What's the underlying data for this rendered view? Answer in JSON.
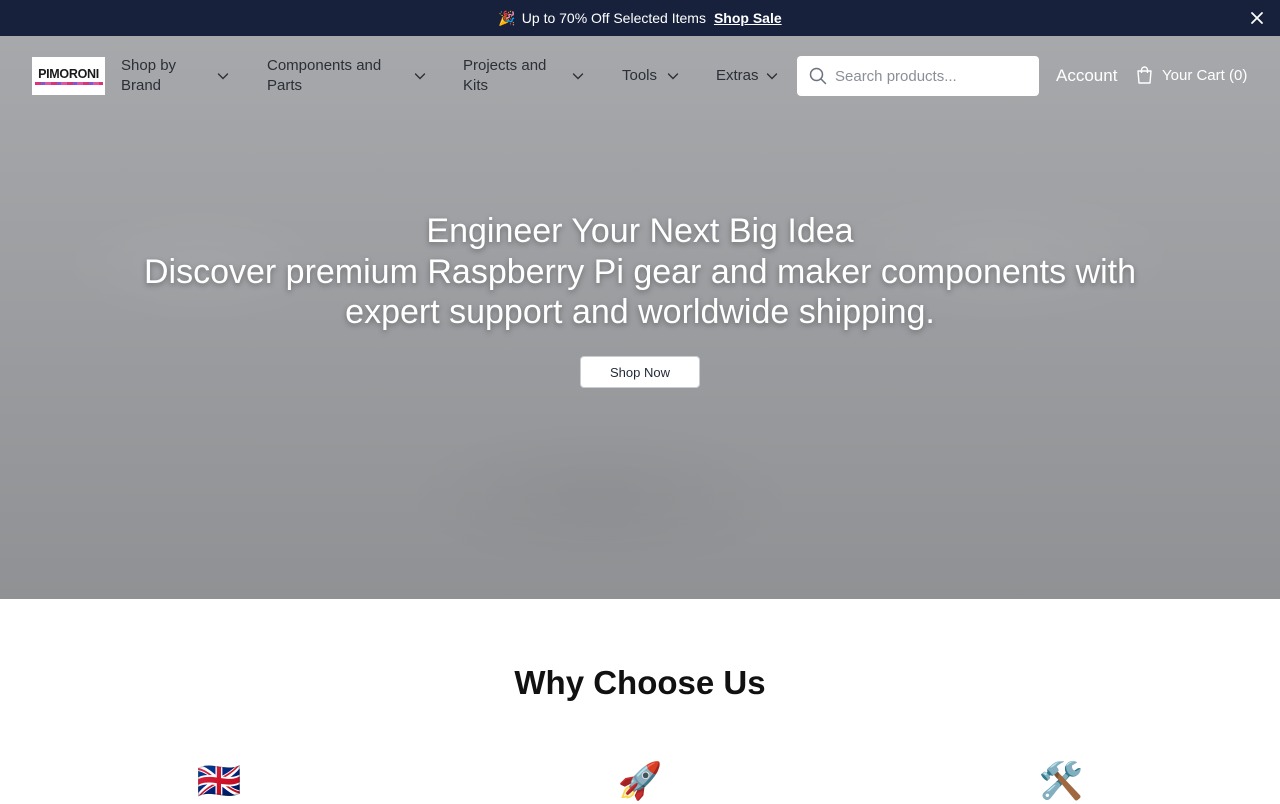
{
  "announcement": {
    "emoji": "🎉",
    "text": "Up to 70% Off Selected Items",
    "link": "Shop Sale"
  },
  "header": {
    "logo_text": "PIMORONI",
    "nav": [
      {
        "line1": "Shop by",
        "line2": "Brand"
      },
      {
        "line1": "Components and",
        "line2": "Parts"
      },
      {
        "line1": "Projects and",
        "line2": "Kits"
      },
      {
        "line1": "Tools",
        "line2": ""
      },
      {
        "line1": "Extras",
        "line2": ""
      }
    ],
    "search": {
      "placeholder": "Search products..."
    },
    "account": "Account",
    "cart": "Your Cart (0)"
  },
  "hero": {
    "title": "Engineer Your Next Big Idea",
    "subtitle": "Discover premium Raspberry Pi gear and maker components with expert support and worldwide shipping.",
    "cta": "Shop Now"
  },
  "why": {
    "title": "Why Choose Us",
    "icons": [
      {
        "glyph": "🇬🇧",
        "name": "uk-flag-icon"
      },
      {
        "glyph": "🚀",
        "name": "rocket-icon"
      },
      {
        "glyph": "🛠️",
        "name": "tools-icon"
      }
    ]
  },
  "colors": {
    "announcement_bg": "#17213c",
    "hero_bg": "#9d9fa2",
    "text_white": "#ffffff"
  }
}
